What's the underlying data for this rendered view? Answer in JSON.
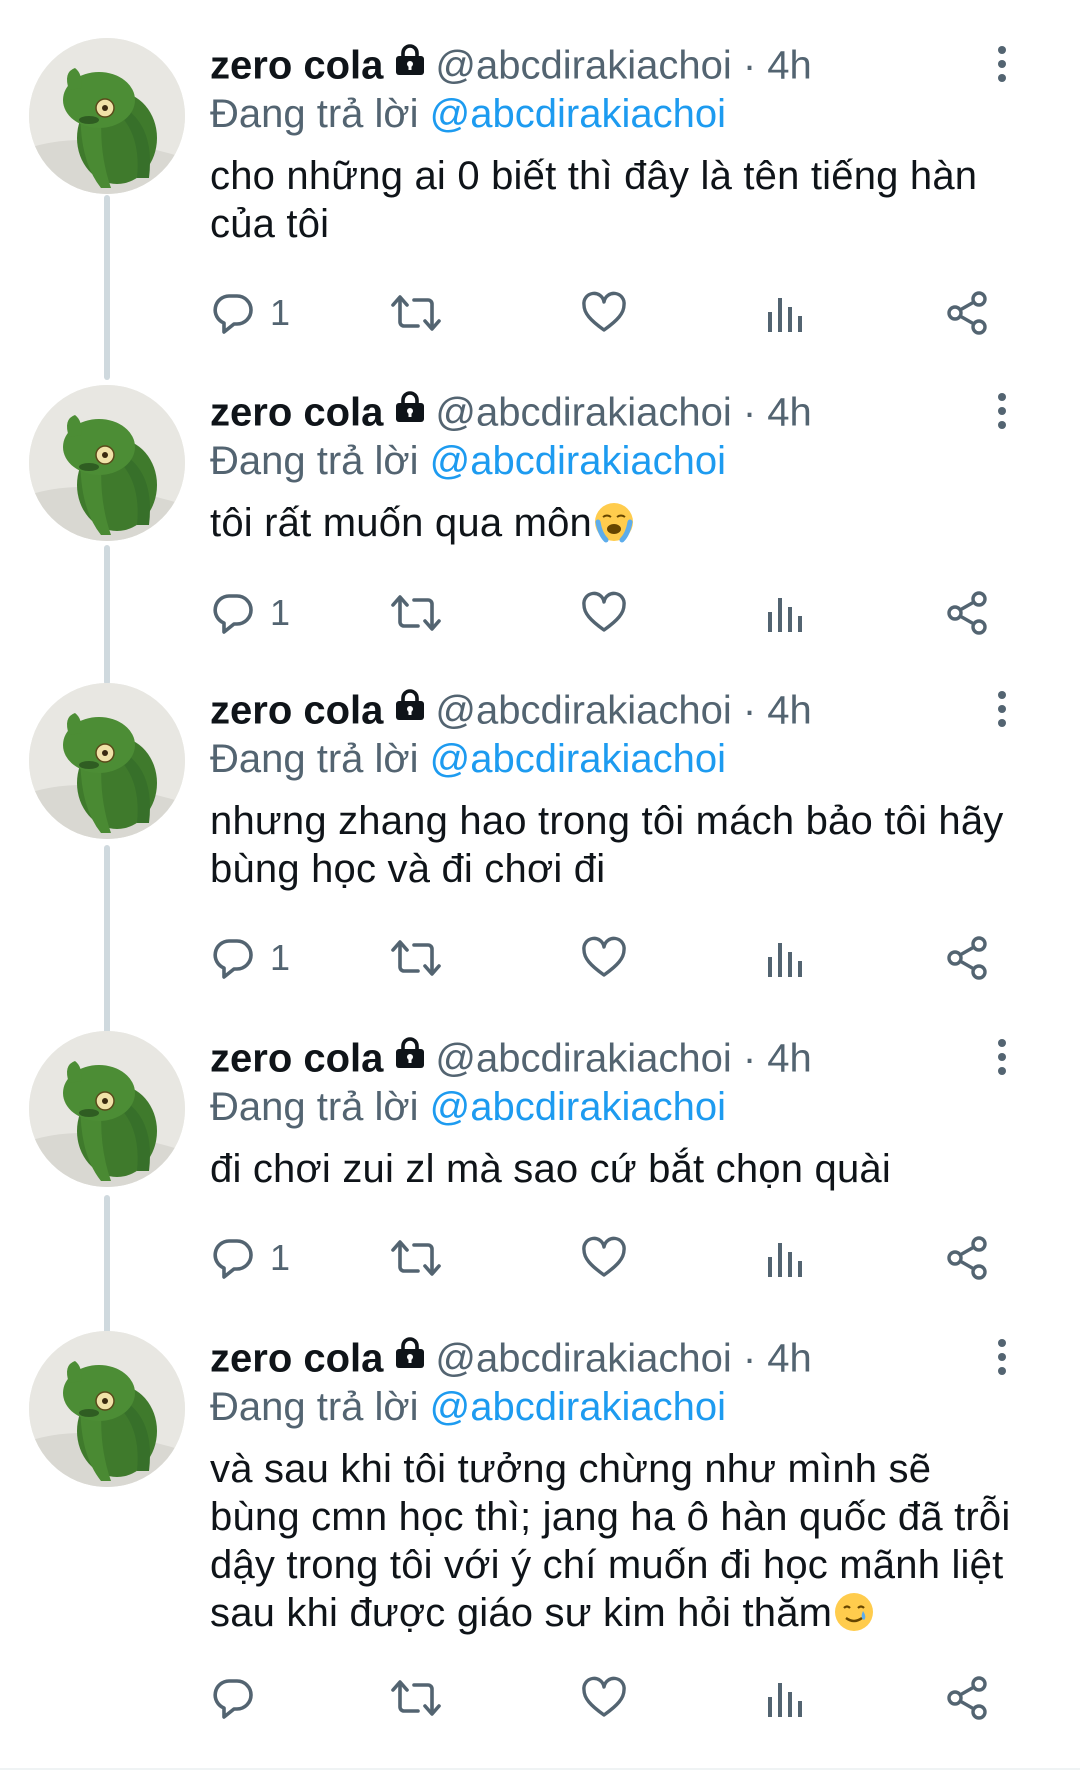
{
  "colors": {
    "link": "#1d9bf0",
    "muted": "#536471",
    "text": "#0f1419"
  },
  "tweets": [
    {
      "name": "zero cola",
      "handle": "@abcdirakiachoi",
      "time": "· 4h",
      "replying_prefix": "Đang trả lời",
      "replying_to": "@abcdirakiachoi",
      "lines": [
        "cho những ai 0 biết thì đây là tên tiếng hàn",
        "của tôi"
      ],
      "reply_count": "1"
    },
    {
      "name": "zero cola",
      "handle": "@abcdirakiachoi",
      "time": "· 4h",
      "replying_prefix": "Đang trả lời",
      "replying_to": "@abcdirakiachoi",
      "lines": [
        "tôi rất muốn qua môn"
      ],
      "emoji": "loudly-crying-face",
      "reply_count": "1"
    },
    {
      "name": "zero cola",
      "handle": "@abcdirakiachoi",
      "time": "· 4h",
      "replying_prefix": "Đang trả lời",
      "replying_to": "@abcdirakiachoi",
      "lines": [
        "nhưng zhang hao trong tôi mách bảo tôi hãy",
        "bùng học và đi chơi đi"
      ],
      "reply_count": "1"
    },
    {
      "name": "zero cola",
      "handle": "@abcdirakiachoi",
      "time": "· 4h",
      "replying_prefix": "Đang trả lời",
      "replying_to": "@abcdirakiachoi",
      "lines": [
        "đi chơi zui zl mà sao cứ bắt chọn quài"
      ],
      "reply_count": "1"
    },
    {
      "name": "zero cola",
      "handle": "@abcdirakiachoi",
      "time": "· 4h",
      "replying_prefix": "Đang trả lời",
      "replying_to": "@abcdirakiachoi",
      "lines": [
        "và sau khi tôi tưởng chừng như mình sẽ",
        "bùng cmn học thì; jang ha ô hàn quốc đã trỗi",
        "dậy trong tôi với ý chí muốn đi học mãnh liệt",
        "sau khi được giáo sư kim hỏi thăm"
      ],
      "emoji": "smiling-face-with-tear",
      "reply_count": ""
    }
  ]
}
